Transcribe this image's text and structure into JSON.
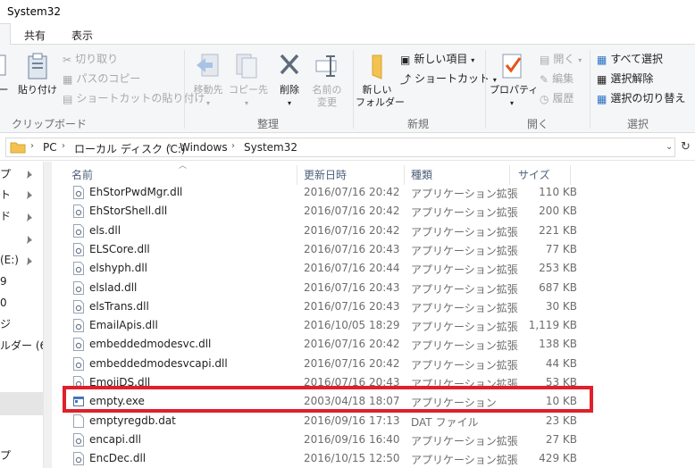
{
  "window": {
    "title": "System32"
  },
  "tabs": [
    "共有",
    "表示"
  ],
  "ribbon": {
    "clipboard": {
      "partial_copy": "ー",
      "paste": "貼り付け",
      "cut": "切り取り",
      "copy_path": "パスのコピー",
      "paste_shortcut": "ショートカットの貼り付け",
      "label": "クリップボード"
    },
    "organize": {
      "move_to": "移動先",
      "copy_to": "コピー先",
      "delete": "削除",
      "rename_1": "名前の",
      "rename_2": "変更",
      "label": "整理"
    },
    "new": {
      "new_folder_1": "新しい",
      "new_folder_2": "フォルダー",
      "new_item": "新しい項目",
      "shortcut": "ショートカット",
      "label": "新規"
    },
    "open": {
      "properties": "プロパティ",
      "open": "開く",
      "edit": "編集",
      "history": "履歴",
      "label": "開く"
    },
    "select": {
      "select_all": "すべて選択",
      "select_none": "選択解除",
      "invert": "選択の切り替え",
      "label": "選択"
    }
  },
  "address": {
    "crumbs": [
      "PC",
      "ローカル ディスク (C:)",
      "Windows",
      "System32"
    ]
  },
  "navpane": {
    "items": [
      "プ",
      "ト",
      "ド",
      "",
      "(E:)",
      "9",
      "0",
      "ジ",
      "ルダー (6)",
      "",
      "",
      "プ"
    ]
  },
  "columns": {
    "name": "名前",
    "date": "更新日時",
    "type": "種類",
    "size": "サイズ"
  },
  "files": [
    {
      "name": "EhStorPwdMgr.dll",
      "date": "2016/07/16 20:42",
      "type": "アプリケーション拡張",
      "size": "110 KB"
    },
    {
      "name": "EhStorShell.dll",
      "date": "2016/07/16 20:42",
      "type": "アプリケーション拡張",
      "size": "200 KB"
    },
    {
      "name": "els.dll",
      "date": "2016/07/16 20:42",
      "type": "アプリケーション拡張",
      "size": "221 KB"
    },
    {
      "name": "ELSCore.dll",
      "date": "2016/07/16 20:43",
      "type": "アプリケーション拡張",
      "size": "77 KB"
    },
    {
      "name": "elshyph.dll",
      "date": "2016/07/16 20:44",
      "type": "アプリケーション拡張",
      "size": "253 KB"
    },
    {
      "name": "elslad.dll",
      "date": "2016/07/16 20:43",
      "type": "アプリケーション拡張",
      "size": "687 KB"
    },
    {
      "name": "elsTrans.dll",
      "date": "2016/07/16 20:43",
      "type": "アプリケーション拡張",
      "size": "30 KB"
    },
    {
      "name": "EmailApis.dll",
      "date": "2016/10/05 18:29",
      "type": "アプリケーション拡張",
      "size": "1,119 KB"
    },
    {
      "name": "embeddedmodesvc.dll",
      "date": "2016/07/16 20:42",
      "type": "アプリケーション拡張",
      "size": "138 KB"
    },
    {
      "name": "embeddedmodesvcapi.dll",
      "date": "2016/07/16 20:42",
      "type": "アプリケーション拡張",
      "size": "44 KB"
    },
    {
      "name": "EmojiDS.dll",
      "date": "2016/07/16 20:43",
      "type": "アプリケーション拡張",
      "size": "53 KB"
    },
    {
      "name": "empty.exe",
      "date": "2003/04/18 18:07",
      "type": "アプリケーション",
      "size": "10 KB"
    },
    {
      "name": "emptyregdb.dat",
      "date": "2016/09/16 17:13",
      "type": "DAT ファイル",
      "size": "23 KB"
    },
    {
      "name": "encapi.dll",
      "date": "2016/09/16 16:40",
      "type": "アプリケーション拡張",
      "size": "27 KB"
    },
    {
      "name": "EncDec.dll",
      "date": "2016/10/15 12:50",
      "type": "アプリケーション拡張",
      "size": "429 KB"
    }
  ],
  "colors": {
    "highlight": "#e0202a",
    "ribbon_bg": "#f5f6f7",
    "header_text": "#4c607a"
  }
}
